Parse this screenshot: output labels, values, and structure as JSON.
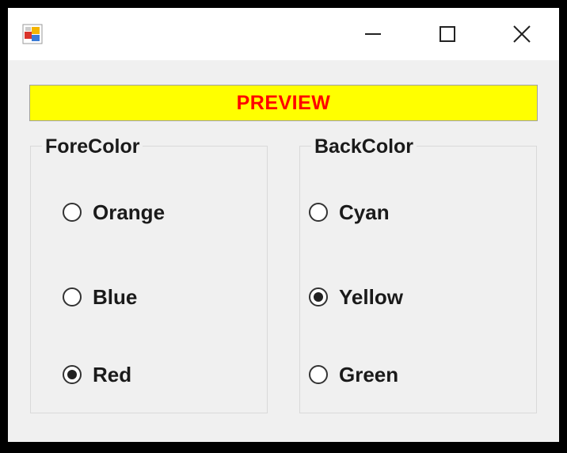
{
  "window": {
    "title": ""
  },
  "titlebar": {
    "icons": [
      "app-icon",
      "minimize-icon",
      "maximize-icon",
      "close-icon"
    ]
  },
  "preview": {
    "text": "PREVIEW",
    "fore_color": "#ff0000",
    "back_color": "#ffff00"
  },
  "forecolor_group": {
    "title": "ForeColor",
    "options": [
      {
        "label": "Orange",
        "checked": false
      },
      {
        "label": "Blue",
        "checked": false
      },
      {
        "label": "Red",
        "checked": true
      }
    ]
  },
  "backcolor_group": {
    "title": "BackColor",
    "options": [
      {
        "label": "Cyan",
        "checked": false
      },
      {
        "label": "Yellow",
        "checked": true
      },
      {
        "label": "Green",
        "checked": false
      }
    ]
  }
}
